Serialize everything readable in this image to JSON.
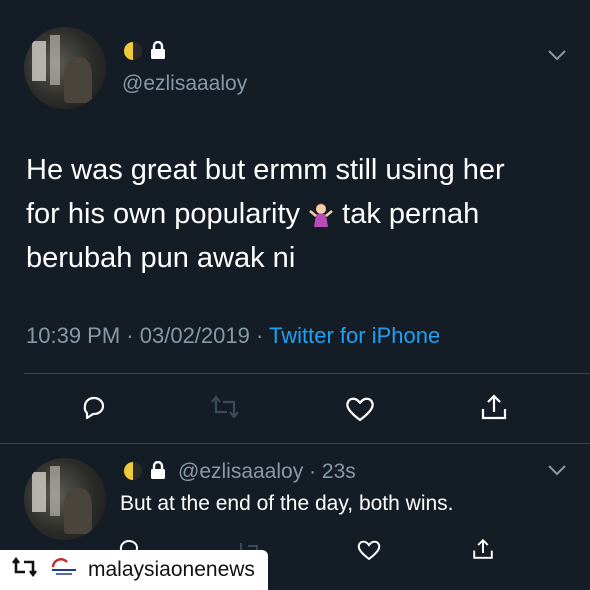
{
  "tweet": {
    "handle": "@ezlisaaaloy",
    "text_line1": "He was great but ermm still using her",
    "text_line2_a": "for his own popularity",
    "text_line2_b": "tak pernah",
    "text_line3": "berubah pun awak ni",
    "emoji": "shrug-emoji",
    "time": "10:39 PM",
    "date": "03/02/2019",
    "source": "Twitter for iPhone",
    "separator": "·",
    "actions": [
      "reply-icon",
      "retweet-icon",
      "like-icon",
      "share-icon"
    ]
  },
  "reply": {
    "handle": "@ezlisaaaloy",
    "age": "23s",
    "text": "But at the end of the day, both wins."
  },
  "repost": {
    "account": "malaysiaonenews"
  },
  "colors": {
    "background": "#141d26",
    "secondary_text": "#8899a6",
    "link": "#1da1f2",
    "divider": "#38444d"
  }
}
